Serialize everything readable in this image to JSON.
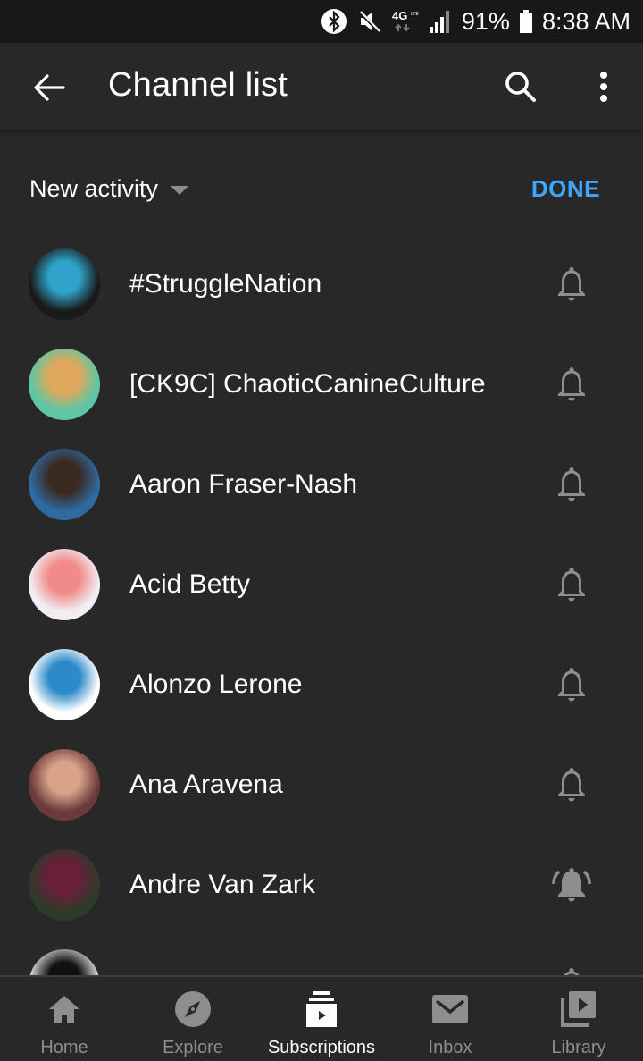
{
  "status_bar": {
    "network": "4G LTE",
    "battery": "91%",
    "time": "8:38 AM",
    "icons": [
      "bluetooth-icon",
      "mute-icon",
      "network-4g-icon",
      "signal-icon",
      "battery-icon"
    ]
  },
  "app_bar": {
    "title": "Channel list",
    "back_icon": "arrow-left-icon",
    "search_icon": "search-icon",
    "more_icon": "more-vert-icon"
  },
  "filter": {
    "sort_label": "New activity",
    "done_label": "DONE"
  },
  "colors": {
    "accent": "#3ea6ff",
    "background": "#282828",
    "status_bar": "#181818",
    "icon_gray": "#8e8e8e"
  },
  "channels": [
    {
      "name": "#StruggleNation",
      "notification": "personalized",
      "avatar_colors": [
        "#1a1a1a",
        "#2fa3c9"
      ]
    },
    {
      "name": "[CK9C] ChaoticCanineCulture",
      "notification": "personalized",
      "avatar_colors": [
        "#5cc6a6",
        "#e0a85a"
      ]
    },
    {
      "name": "Aaron Fraser-Nash",
      "notification": "personalized",
      "avatar_colors": [
        "#2f6aa0",
        "#3a2a22"
      ]
    },
    {
      "name": "Acid Betty",
      "notification": "personalized",
      "avatar_colors": [
        "#f0eef2",
        "#f28a8a"
      ]
    },
    {
      "name": "Alonzo Lerone",
      "notification": "personalized",
      "avatar_colors": [
        "#ffffff",
        "#2c8ac9"
      ]
    },
    {
      "name": "Ana Aravena",
      "notification": "personalized",
      "avatar_colors": [
        "#6b3a3a",
        "#d9a38a"
      ]
    },
    {
      "name": "Andre Van Zark",
      "notification": "all",
      "avatar_colors": [
        "#2e3b2a",
        "#6a1f3a"
      ]
    },
    {
      "name": "",
      "notification": "personalized",
      "avatar_colors": [
        "#d8d8d8",
        "#111111"
      ]
    }
  ],
  "bottom_nav": [
    {
      "label": "Home",
      "icon": "home-icon",
      "active": false
    },
    {
      "label": "Explore",
      "icon": "compass-icon",
      "active": false
    },
    {
      "label": "Subscriptions",
      "icon": "subscriptions-icon",
      "active": true
    },
    {
      "label": "Inbox",
      "icon": "inbox-icon",
      "active": false
    },
    {
      "label": "Library",
      "icon": "library-icon",
      "active": false
    }
  ]
}
